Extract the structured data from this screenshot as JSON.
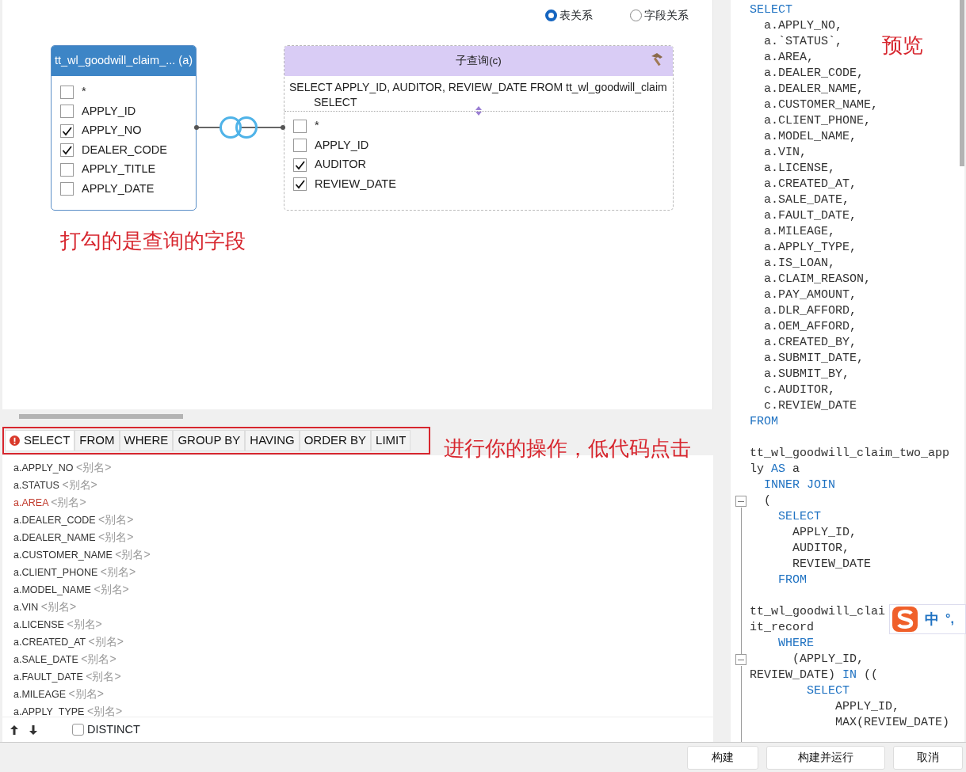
{
  "view_toggle": [
    {
      "label": "表关系",
      "selected": true
    },
    {
      "label": "字段关系",
      "selected": false
    }
  ],
  "tables": [
    {
      "kind": "table",
      "title": "tt_wl_goodwill_claim_... (a)",
      "fields": [
        {
          "name": "*",
          "checked": false
        },
        {
          "name": "APPLY_ID",
          "checked": false
        },
        {
          "name": "APPLY_NO",
          "checked": true
        },
        {
          "name": "DEALER_CODE",
          "checked": true
        },
        {
          "name": "APPLY_TITLE",
          "checked": false
        },
        {
          "name": "APPLY_DATE",
          "checked": false
        }
      ]
    },
    {
      "kind": "subquery",
      "title": "子查询(c)",
      "sql": "SELECT  APPLY_ID,   AUDITOR,   REVIEW_DATE FROM  tt_wl_goodwill_claim",
      "sql_next": "SELECT",
      "fields": [
        {
          "name": "*",
          "checked": false
        },
        {
          "name": "APPLY_ID",
          "checked": false
        },
        {
          "name": "AUDITOR",
          "checked": true
        },
        {
          "name": "REVIEW_DATE",
          "checked": true
        }
      ]
    }
  ],
  "canvas_note": "打勾的是查询的字段",
  "clause_tabs": [
    {
      "label": "SELECT",
      "selected": true,
      "error": true
    },
    {
      "label": "FROM",
      "selected": false,
      "error": false
    },
    {
      "label": "WHERE",
      "selected": false,
      "error": false
    },
    {
      "label": "GROUP BY",
      "selected": false,
      "error": false
    },
    {
      "label": "HAVING",
      "selected": false,
      "error": false
    },
    {
      "label": "ORDER BY",
      "selected": false,
      "error": false
    },
    {
      "label": "LIMIT",
      "selected": false,
      "error": false
    }
  ],
  "tabs_note": "进行你的操作，低代码点击",
  "select_fields": [
    {
      "field": "a.APPLY_NO",
      "alias": "<别名>",
      "error": false
    },
    {
      "field": "a.STATUS",
      "alias": "<别名>",
      "error": false
    },
    {
      "field": "a.AREA",
      "alias": "<别名>",
      "error": true
    },
    {
      "field": "a.DEALER_CODE",
      "alias": "<别名>",
      "error": false
    },
    {
      "field": "a.DEALER_NAME",
      "alias": "<别名>",
      "error": false
    },
    {
      "field": "a.CUSTOMER_NAME",
      "alias": "<别名>",
      "error": false
    },
    {
      "field": "a.CLIENT_PHONE",
      "alias": "<别名>",
      "error": false
    },
    {
      "field": "a.MODEL_NAME",
      "alias": "<别名>",
      "error": false
    },
    {
      "field": "a.VIN",
      "alias": "<别名>",
      "error": false
    },
    {
      "field": "a.LICENSE",
      "alias": "<别名>",
      "error": false
    },
    {
      "field": "a.CREATED_AT",
      "alias": "<别名>",
      "error": false
    },
    {
      "field": "a.SALE_DATE",
      "alias": "<别名>",
      "error": false
    },
    {
      "field": "a.FAULT_DATE",
      "alias": "<别名>",
      "error": false
    },
    {
      "field": "a.MILEAGE",
      "alias": "<别名>",
      "error": false
    },
    {
      "field": "a.APPLY_TYPE",
      "alias": "<别名>",
      "error": false
    }
  ],
  "distinct": {
    "label": "DISTINCT",
    "checked": false
  },
  "preview_note": "预览",
  "preview_lines": [
    {
      "kind": "code",
      "fold": false,
      "segs": [
        {
          "text": "SELECT",
          "keyword": true
        }
      ]
    },
    {
      "kind": "code",
      "fold": false,
      "segs": [
        {
          "text": "  a.APPLY_NO,",
          "keyword": false
        }
      ]
    },
    {
      "kind": "code",
      "fold": false,
      "segs": [
        {
          "text": "  a.`STATUS`,",
          "keyword": false
        }
      ]
    },
    {
      "kind": "code",
      "fold": false,
      "segs": [
        {
          "text": "  a.AREA,",
          "keyword": false
        }
      ]
    },
    {
      "kind": "code",
      "fold": false,
      "segs": [
        {
          "text": "  a.DEALER_CODE,",
          "keyword": false
        }
      ]
    },
    {
      "kind": "code",
      "fold": false,
      "segs": [
        {
          "text": "  a.DEALER_NAME,",
          "keyword": false
        }
      ]
    },
    {
      "kind": "code",
      "fold": false,
      "segs": [
        {
          "text": "  a.CUSTOMER_NAME,",
          "keyword": false
        }
      ]
    },
    {
      "kind": "code",
      "fold": false,
      "segs": [
        {
          "text": "  a.CLIENT_PHONE,",
          "keyword": false
        }
      ]
    },
    {
      "kind": "code",
      "fold": false,
      "segs": [
        {
          "text": "  a.MODEL_NAME,",
          "keyword": false
        }
      ]
    },
    {
      "kind": "code",
      "fold": false,
      "segs": [
        {
          "text": "  a.VIN,",
          "keyword": false
        }
      ]
    },
    {
      "kind": "code",
      "fold": false,
      "segs": [
        {
          "text": "  a.LICENSE,",
          "keyword": false
        }
      ]
    },
    {
      "kind": "code",
      "fold": false,
      "segs": [
        {
          "text": "  a.CREATED_AT,",
          "keyword": false
        }
      ]
    },
    {
      "kind": "code",
      "fold": false,
      "segs": [
        {
          "text": "  a.SALE_DATE,",
          "keyword": false
        }
      ]
    },
    {
      "kind": "code",
      "fold": false,
      "segs": [
        {
          "text": "  a.FAULT_DATE,",
          "keyword": false
        }
      ]
    },
    {
      "kind": "code",
      "fold": false,
      "segs": [
        {
          "text": "  a.MILEAGE,",
          "keyword": false
        }
      ]
    },
    {
      "kind": "code",
      "fold": false,
      "segs": [
        {
          "text": "  a.APPLY_TYPE,",
          "keyword": false
        }
      ]
    },
    {
      "kind": "code",
      "fold": false,
      "segs": [
        {
          "text": "  a.IS_LOAN,",
          "keyword": false
        }
      ]
    },
    {
      "kind": "code",
      "fold": false,
      "segs": [
        {
          "text": "  a.CLAIM_REASON,",
          "keyword": false
        }
      ]
    },
    {
      "kind": "code",
      "fold": false,
      "segs": [
        {
          "text": "  a.PAY_AMOUNT,",
          "keyword": false
        }
      ]
    },
    {
      "kind": "code",
      "fold": false,
      "segs": [
        {
          "text": "  a.DLR_AFFORD,",
          "keyword": false
        }
      ]
    },
    {
      "kind": "code",
      "fold": false,
      "segs": [
        {
          "text": "  a.OEM_AFFORD,",
          "keyword": false
        }
      ]
    },
    {
      "kind": "code",
      "fold": false,
      "segs": [
        {
          "text": "  a.CREATED_BY,",
          "keyword": false
        }
      ]
    },
    {
      "kind": "code",
      "fold": false,
      "segs": [
        {
          "text": "  a.SUBMIT_DATE,",
          "keyword": false
        }
      ]
    },
    {
      "kind": "code",
      "fold": false,
      "segs": [
        {
          "text": "  a.SUBMIT_BY,",
          "keyword": false
        }
      ]
    },
    {
      "kind": "code",
      "fold": false,
      "segs": [
        {
          "text": "  c.AUDITOR,",
          "keyword": false
        }
      ]
    },
    {
      "kind": "code",
      "fold": false,
      "segs": [
        {
          "text": "  c.REVIEW_DATE",
          "keyword": false
        }
      ]
    },
    {
      "kind": "code",
      "fold": false,
      "segs": [
        {
          "text": "FROM",
          "keyword": true
        }
      ]
    },
    {
      "kind": "blank"
    },
    {
      "kind": "code",
      "fold": false,
      "segs": [
        {
          "text": "tt_wl_goodwill_claim_two_app",
          "keyword": false
        }
      ]
    },
    {
      "kind": "code",
      "fold": false,
      "segs": [
        {
          "text": "ly ",
          "keyword": false
        },
        {
          "text": "AS",
          "keyword": true
        },
        {
          "text": " a",
          "keyword": false
        }
      ]
    },
    {
      "kind": "code",
      "fold": false,
      "segs": [
        {
          "text": "  INNER JOIN",
          "keyword": true
        }
      ]
    },
    {
      "kind": "code",
      "fold": true,
      "segs": [
        {
          "text": "  (",
          "keyword": false
        }
      ]
    },
    {
      "kind": "code",
      "fold": false,
      "segs": [
        {
          "text": "    SELECT",
          "keyword": true
        }
      ]
    },
    {
      "kind": "code",
      "fold": false,
      "segs": [
        {
          "text": "      APPLY_ID,",
          "keyword": false
        }
      ]
    },
    {
      "kind": "code",
      "fold": false,
      "segs": [
        {
          "text": "      AUDITOR,",
          "keyword": false
        }
      ]
    },
    {
      "kind": "code",
      "fold": false,
      "segs": [
        {
          "text": "      REVIEW_DATE",
          "keyword": false
        }
      ]
    },
    {
      "kind": "code",
      "fold": false,
      "segs": [
        {
          "text": "    FROM",
          "keyword": true
        }
      ]
    },
    {
      "kind": "blank"
    },
    {
      "kind": "code",
      "fold": false,
      "segs": [
        {
          "text": "tt_wl_goodwill_clai",
          "keyword": false
        }
      ]
    },
    {
      "kind": "code",
      "fold": false,
      "segs": [
        {
          "text": "it_record",
          "keyword": false
        }
      ]
    },
    {
      "kind": "code",
      "fold": false,
      "segs": [
        {
          "text": "    WHERE",
          "keyword": true
        }
      ]
    },
    {
      "kind": "code",
      "fold": true,
      "segs": [
        {
          "text": "      (APPLY_ID,",
          "keyword": false
        }
      ]
    },
    {
      "kind": "code",
      "fold": false,
      "segs": [
        {
          "text": "REVIEW_DATE) ",
          "keyword": false
        },
        {
          "text": "IN",
          "keyword": true
        },
        {
          "text": " ((",
          "keyword": false
        }
      ]
    },
    {
      "kind": "code",
      "fold": false,
      "segs": [
        {
          "text": "        SELECT",
          "keyword": true
        }
      ]
    },
    {
      "kind": "code",
      "fold": false,
      "segs": [
        {
          "text": "            APPLY_ID,",
          "keyword": false
        }
      ]
    },
    {
      "kind": "code",
      "fold": false,
      "segs": [
        {
          "text": "            MAX(REVIEW_DATE)",
          "keyword": false
        }
      ]
    }
  ],
  "ime": {
    "mode": "中",
    "punct": "°,"
  },
  "buttons": [
    {
      "label": "构建"
    },
    {
      "label": "构建并运行"
    },
    {
      "label": "取消"
    }
  ]
}
